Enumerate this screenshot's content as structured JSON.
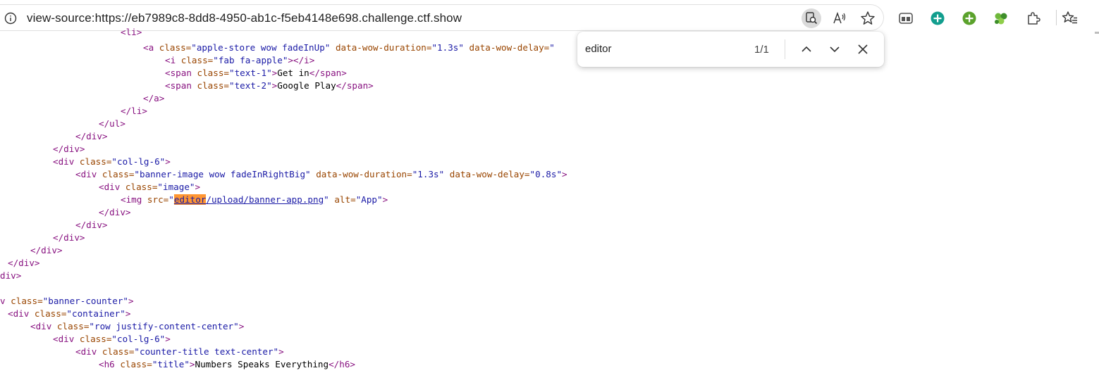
{
  "address_bar": {
    "url": "view-source:https://eb7989c8-8dd8-4950-ab1c-f5eb4148e698.challenge.ctf.show"
  },
  "find_bar": {
    "query": "editor",
    "count": "1/1"
  },
  "source": {
    "l0": {
      "t1": "<li>"
    },
    "l1": {
      "t1": "<a ",
      "a1": "class=",
      "v1": "\"apple-store wow fadeInUp\"",
      "a2": " data-wow-duration=",
      "v2": "\"1.3s\"",
      "a3": " data-wow-delay=",
      "v3": "\""
    },
    "l2": {
      "t1": "<i ",
      "a1": "class=",
      "v1": "\"fab fa-apple\"",
      "t2": "></i>"
    },
    "l3": {
      "t1": "<span ",
      "a1": "class=",
      "v1": "\"text-1\"",
      "t2": ">",
      "x1": "Get in",
      "t3": "</span>"
    },
    "l4": {
      "t1": "<span ",
      "a1": "class=",
      "v1": "\"text-2\"",
      "t2": ">",
      "x1": "Google Play",
      "t3": "</span>"
    },
    "l5": {
      "t1": "</a>"
    },
    "l6": {
      "t1": "</li>"
    },
    "l7": {
      "t1": "</ul>"
    },
    "l8": {
      "t1": "</div>"
    },
    "l9": {
      "t1": "</div>"
    },
    "l10": {
      "t1": "<div ",
      "a1": "class=",
      "v1": "\"col-lg-6\"",
      "t2": ">"
    },
    "l11": {
      "t1": "<div ",
      "a1": "class=",
      "v1": "\"banner-image wow fadeInRightBig\"",
      "a2": " data-wow-duration=",
      "v2": "\"1.3s\"",
      "a3": " data-wow-delay=",
      "v3": "\"0.8s\"",
      "t2": ">"
    },
    "l12": {
      "t1": "<div ",
      "a1": "class=",
      "v1": "\"image\"",
      "t2": ">"
    },
    "l13": {
      "t1": "<img ",
      "a1": "src=",
      "q1": "\"",
      "hl": "editor",
      "link": "/upload/banner-app.png",
      "q2": "\"",
      "a2": " alt=",
      "v2": "\"App\"",
      "t2": ">"
    },
    "l14": {
      "t1": "</div>"
    },
    "l15": {
      "t1": "</div>"
    },
    "l16": {
      "t1": "</div>"
    },
    "l17": {
      "t1": "</div>"
    },
    "l18": {
      "t1": "</div>"
    },
    "l19": {
      "t1": "div>"
    },
    "l20": {
      "t1": "v ",
      "a1": "class=",
      "v1": "\"banner-counter\"",
      "t2": ">"
    },
    "l21": {
      "t1": "<div ",
      "a1": "class=",
      "v1": "\"container\"",
      "t2": ">"
    },
    "l22": {
      "t1": "<div ",
      "a1": "class=",
      "v1": "\"row justify-content-center\"",
      "t2": ">"
    },
    "l23": {
      "t1": "<div ",
      "a1": "class=",
      "v1": "\"col-lg-6\"",
      "t2": ">"
    },
    "l24": {
      "t1": "<div ",
      "a1": "class=",
      "v1": "\"counter-title text-center\"",
      "t2": ">"
    },
    "l25": {
      "t1": "<h6 ",
      "a1": "class=",
      "v1": "\"title\"",
      "t2": ">",
      "x1": "Numbers Speaks Everything",
      "t3": "</h6>"
    }
  }
}
